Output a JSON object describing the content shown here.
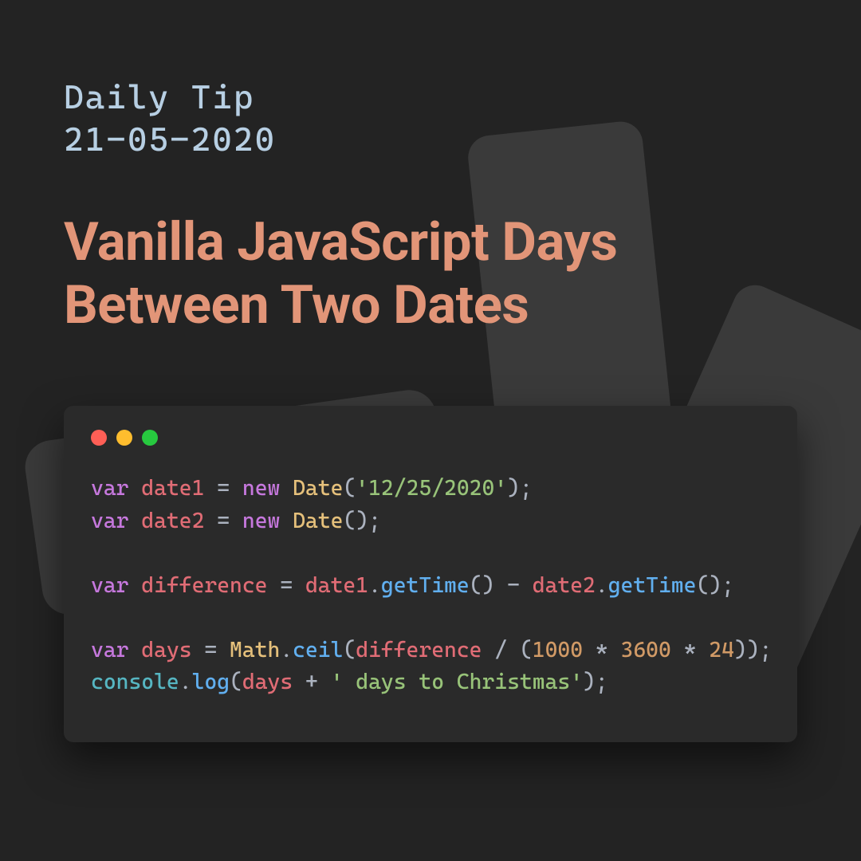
{
  "header": {
    "kicker_line1": "Daily Tip",
    "kicker_line2": "21-05-2020",
    "title": "Vanilla JavaScript Days Between Two Dates"
  },
  "code": {
    "l1_var": "var",
    "l1_name": "date1",
    "l1_eq": " = ",
    "l1_new": "new",
    "l1_cls": "Date",
    "l1_open": "(",
    "l1_str": "'12/25/2020'",
    "l1_close": ");",
    "l2_var": "var",
    "l2_name": "date2",
    "l2_eq": " = ",
    "l2_new": "new",
    "l2_cls": "Date",
    "l2_paren": "();",
    "l4_var": "var",
    "l4_name": "difference",
    "l4_eq": " = ",
    "l4_d1": "date1",
    "l4_dot1": ".",
    "l4_gt1": "getTime",
    "l4_p1": "() - ",
    "l4_d2": "date2",
    "l4_dot2": ".",
    "l4_gt2": "getTime",
    "l4_p2": "();",
    "l6_var": "var",
    "l6_name": "days",
    "l6_eq": " = ",
    "l6_math": "Math",
    "l6_dot": ".",
    "l6_ceil": "ceil",
    "l6_open": "(",
    "l6_diff": "difference",
    "l6_div": " / (",
    "l6_n1": "1000",
    "l6_m1": " * ",
    "l6_n2": "3600",
    "l6_m2": " * ",
    "l6_n3": "24",
    "l6_close": "));",
    "l7_console": "console",
    "l7_dot": ".",
    "l7_log": "log",
    "l7_open": "(",
    "l7_days": "days",
    "l7_plus": " + ",
    "l7_str": "' days to Christmas'",
    "l7_close": ");"
  }
}
